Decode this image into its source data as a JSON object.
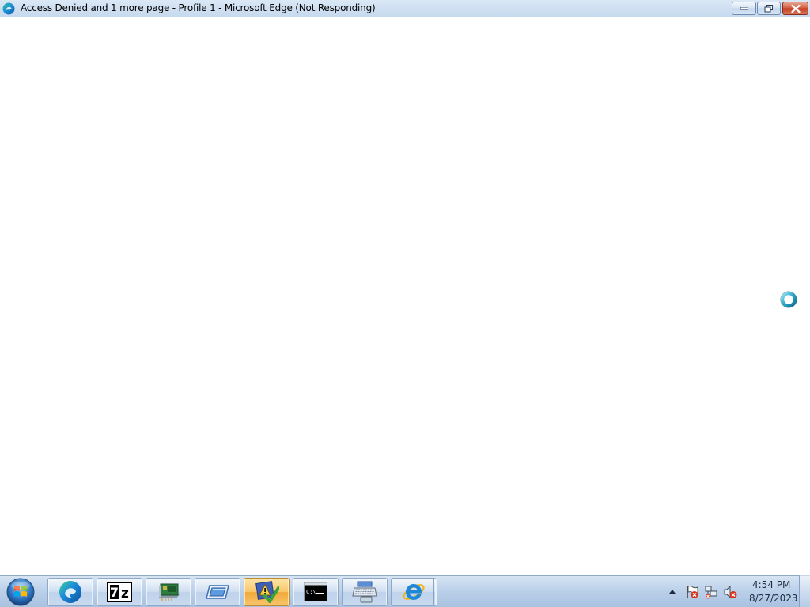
{
  "window": {
    "title": "Access Denied and 1 more page - Profile 1 - Microsoft Edge (Not Responding)",
    "app_icon": "edge-icon",
    "controls": [
      "minimize-icon",
      "restore-icon",
      "close-icon"
    ]
  },
  "cursor": "busy-cursor-icon",
  "taskbar": {
    "start": "windows-start-orb-icon",
    "pinned": [
      {
        "icon": "edge-icon",
        "active": false
      },
      {
        "icon": "7zip-icon",
        "active": false
      },
      {
        "icon": "network-card-icon",
        "active": false
      },
      {
        "icon": "remote-desktop-icon",
        "active": false
      },
      {
        "icon": "action-center-icon",
        "active": true
      },
      {
        "icon": "command-prompt-icon",
        "active": false
      },
      {
        "icon": "keyboard-computer-icon",
        "active": false
      },
      {
        "icon": "internet-explorer-icon",
        "active": false
      }
    ],
    "tray": {
      "icons": [
        "show-hidden-icons-arrow",
        "action-center-flag-icon",
        "network-disconnected-icon",
        "volume-muted-icon"
      ],
      "time": "4:54 PM",
      "date": "8/27/2023"
    }
  },
  "colors": {
    "titlebar": "#c6d9ee",
    "taskbar": "#bcd1ea",
    "close_button": "#c33b1e",
    "active_taskbar_button": "#f8c66a"
  }
}
